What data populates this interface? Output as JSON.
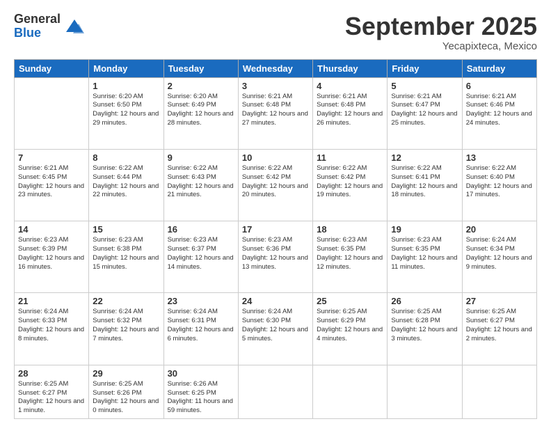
{
  "logo": {
    "general": "General",
    "blue": "Blue"
  },
  "header": {
    "month": "September 2025",
    "location": "Yecapixteca, Mexico"
  },
  "weekdays": [
    "Sunday",
    "Monday",
    "Tuesday",
    "Wednesday",
    "Thursday",
    "Friday",
    "Saturday"
  ],
  "weeks": [
    [
      {
        "day": "",
        "sunrise": "",
        "sunset": "",
        "daylight": ""
      },
      {
        "day": "1",
        "sunrise": "Sunrise: 6:20 AM",
        "sunset": "Sunset: 6:50 PM",
        "daylight": "Daylight: 12 hours and 29 minutes."
      },
      {
        "day": "2",
        "sunrise": "Sunrise: 6:20 AM",
        "sunset": "Sunset: 6:49 PM",
        "daylight": "Daylight: 12 hours and 28 minutes."
      },
      {
        "day": "3",
        "sunrise": "Sunrise: 6:21 AM",
        "sunset": "Sunset: 6:48 PM",
        "daylight": "Daylight: 12 hours and 27 minutes."
      },
      {
        "day": "4",
        "sunrise": "Sunrise: 6:21 AM",
        "sunset": "Sunset: 6:48 PM",
        "daylight": "Daylight: 12 hours and 26 minutes."
      },
      {
        "day": "5",
        "sunrise": "Sunrise: 6:21 AM",
        "sunset": "Sunset: 6:47 PM",
        "daylight": "Daylight: 12 hours and 25 minutes."
      },
      {
        "day": "6",
        "sunrise": "Sunrise: 6:21 AM",
        "sunset": "Sunset: 6:46 PM",
        "daylight": "Daylight: 12 hours and 24 minutes."
      }
    ],
    [
      {
        "day": "7",
        "sunrise": "Sunrise: 6:21 AM",
        "sunset": "Sunset: 6:45 PM",
        "daylight": "Daylight: 12 hours and 23 minutes."
      },
      {
        "day": "8",
        "sunrise": "Sunrise: 6:22 AM",
        "sunset": "Sunset: 6:44 PM",
        "daylight": "Daylight: 12 hours and 22 minutes."
      },
      {
        "day": "9",
        "sunrise": "Sunrise: 6:22 AM",
        "sunset": "Sunset: 6:43 PM",
        "daylight": "Daylight: 12 hours and 21 minutes."
      },
      {
        "day": "10",
        "sunrise": "Sunrise: 6:22 AM",
        "sunset": "Sunset: 6:42 PM",
        "daylight": "Daylight: 12 hours and 20 minutes."
      },
      {
        "day": "11",
        "sunrise": "Sunrise: 6:22 AM",
        "sunset": "Sunset: 6:42 PM",
        "daylight": "Daylight: 12 hours and 19 minutes."
      },
      {
        "day": "12",
        "sunrise": "Sunrise: 6:22 AM",
        "sunset": "Sunset: 6:41 PM",
        "daylight": "Daylight: 12 hours and 18 minutes."
      },
      {
        "day": "13",
        "sunrise": "Sunrise: 6:22 AM",
        "sunset": "Sunset: 6:40 PM",
        "daylight": "Daylight: 12 hours and 17 minutes."
      }
    ],
    [
      {
        "day": "14",
        "sunrise": "Sunrise: 6:23 AM",
        "sunset": "Sunset: 6:39 PM",
        "daylight": "Daylight: 12 hours and 16 minutes."
      },
      {
        "day": "15",
        "sunrise": "Sunrise: 6:23 AM",
        "sunset": "Sunset: 6:38 PM",
        "daylight": "Daylight: 12 hours and 15 minutes."
      },
      {
        "day": "16",
        "sunrise": "Sunrise: 6:23 AM",
        "sunset": "Sunset: 6:37 PM",
        "daylight": "Daylight: 12 hours and 14 minutes."
      },
      {
        "day": "17",
        "sunrise": "Sunrise: 6:23 AM",
        "sunset": "Sunset: 6:36 PM",
        "daylight": "Daylight: 12 hours and 13 minutes."
      },
      {
        "day": "18",
        "sunrise": "Sunrise: 6:23 AM",
        "sunset": "Sunset: 6:35 PM",
        "daylight": "Daylight: 12 hours and 12 minutes."
      },
      {
        "day": "19",
        "sunrise": "Sunrise: 6:23 AM",
        "sunset": "Sunset: 6:35 PM",
        "daylight": "Daylight: 12 hours and 11 minutes."
      },
      {
        "day": "20",
        "sunrise": "Sunrise: 6:24 AM",
        "sunset": "Sunset: 6:34 PM",
        "daylight": "Daylight: 12 hours and 9 minutes."
      }
    ],
    [
      {
        "day": "21",
        "sunrise": "Sunrise: 6:24 AM",
        "sunset": "Sunset: 6:33 PM",
        "daylight": "Daylight: 12 hours and 8 minutes."
      },
      {
        "day": "22",
        "sunrise": "Sunrise: 6:24 AM",
        "sunset": "Sunset: 6:32 PM",
        "daylight": "Daylight: 12 hours and 7 minutes."
      },
      {
        "day": "23",
        "sunrise": "Sunrise: 6:24 AM",
        "sunset": "Sunset: 6:31 PM",
        "daylight": "Daylight: 12 hours and 6 minutes."
      },
      {
        "day": "24",
        "sunrise": "Sunrise: 6:24 AM",
        "sunset": "Sunset: 6:30 PM",
        "daylight": "Daylight: 12 hours and 5 minutes."
      },
      {
        "day": "25",
        "sunrise": "Sunrise: 6:25 AM",
        "sunset": "Sunset: 6:29 PM",
        "daylight": "Daylight: 12 hours and 4 minutes."
      },
      {
        "day": "26",
        "sunrise": "Sunrise: 6:25 AM",
        "sunset": "Sunset: 6:28 PM",
        "daylight": "Daylight: 12 hours and 3 minutes."
      },
      {
        "day": "27",
        "sunrise": "Sunrise: 6:25 AM",
        "sunset": "Sunset: 6:27 PM",
        "daylight": "Daylight: 12 hours and 2 minutes."
      }
    ],
    [
      {
        "day": "28",
        "sunrise": "Sunrise: 6:25 AM",
        "sunset": "Sunset: 6:27 PM",
        "daylight": "Daylight: 12 hours and 1 minute."
      },
      {
        "day": "29",
        "sunrise": "Sunrise: 6:25 AM",
        "sunset": "Sunset: 6:26 PM",
        "daylight": "Daylight: 12 hours and 0 minutes."
      },
      {
        "day": "30",
        "sunrise": "Sunrise: 6:26 AM",
        "sunset": "Sunset: 6:25 PM",
        "daylight": "Daylight: 11 hours and 59 minutes."
      },
      {
        "day": "",
        "sunrise": "",
        "sunset": "",
        "daylight": ""
      },
      {
        "day": "",
        "sunrise": "",
        "sunset": "",
        "daylight": ""
      },
      {
        "day": "",
        "sunrise": "",
        "sunset": "",
        "daylight": ""
      },
      {
        "day": "",
        "sunrise": "",
        "sunset": "",
        "daylight": ""
      }
    ]
  ]
}
